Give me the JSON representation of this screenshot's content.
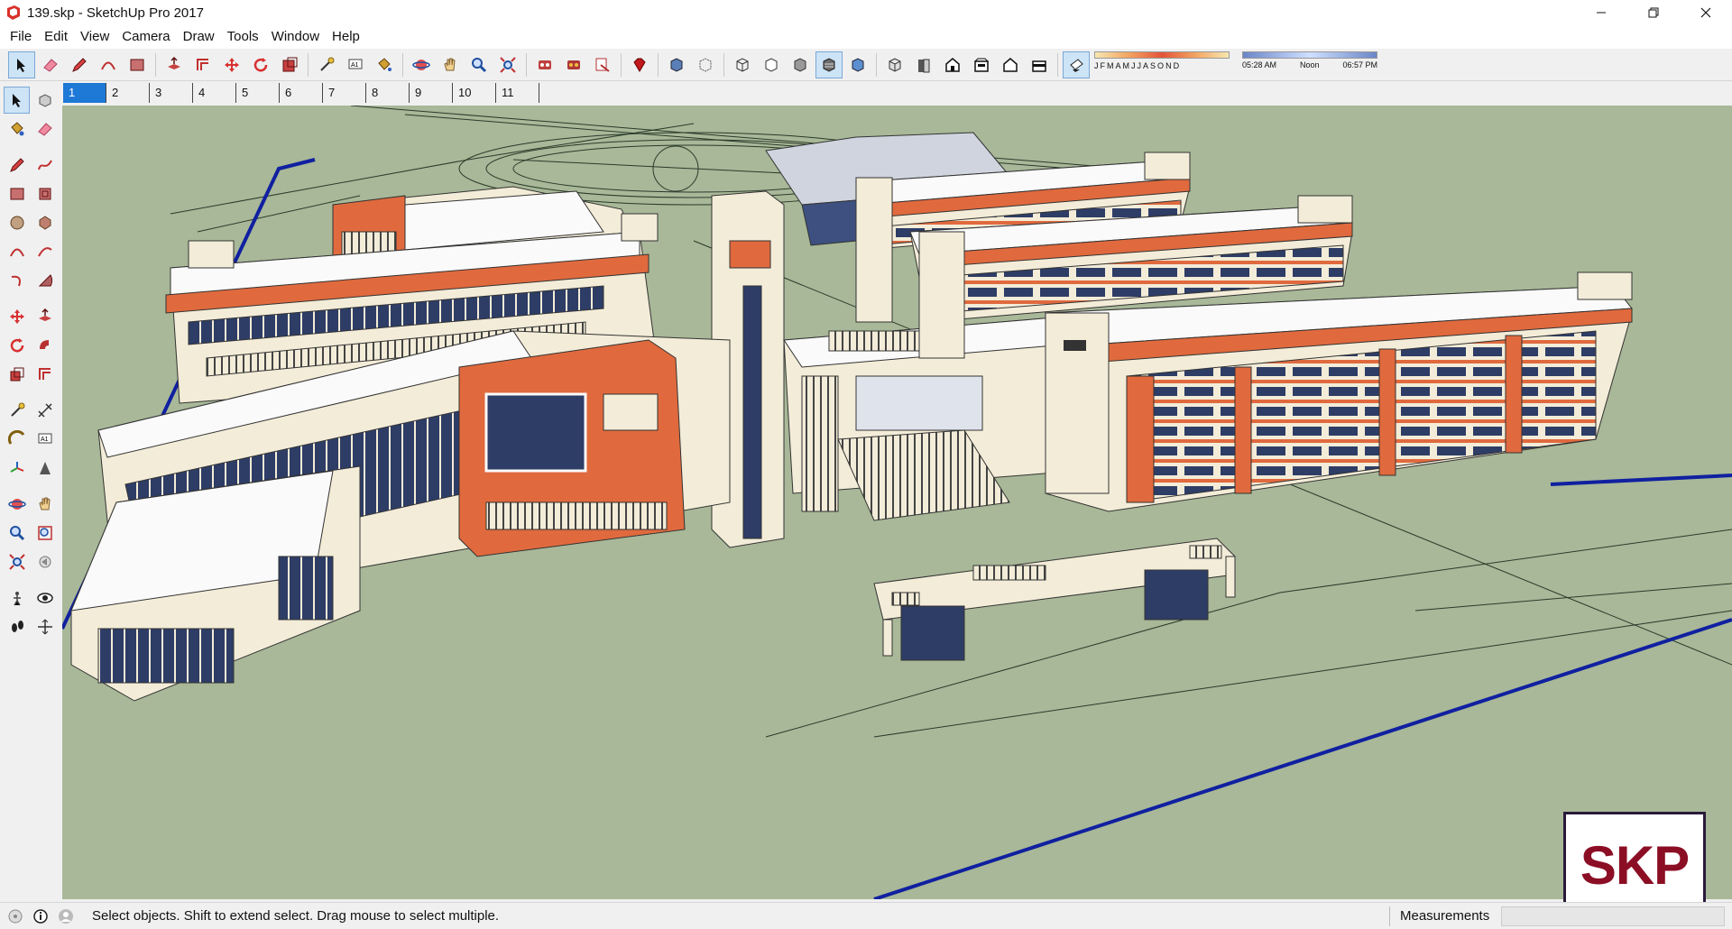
{
  "window": {
    "title": "139.skp - SketchUp Pro 2017",
    "app_icon": "sketchup-logo-icon",
    "controls": [
      "minimize-icon",
      "restore-icon",
      "close-icon"
    ]
  },
  "menu": {
    "items": [
      "File",
      "Edit",
      "View",
      "Camera",
      "Draw",
      "Tools",
      "Window",
      "Help"
    ]
  },
  "toolbar": {
    "groups": [
      [
        "select-icon",
        "eraser-icon",
        "pencil-icon",
        "arc-icon",
        "rectangle-icon"
      ],
      [
        "push-pull-icon",
        "offset-icon",
        "move-icon",
        "rotate-icon",
        "scale-icon"
      ],
      [
        "tape-measure-icon",
        "text-icon",
        "paint-bucket-icon"
      ],
      [
        "orbit-icon",
        "pan-icon",
        "zoom-icon",
        "zoom-extents-icon"
      ],
      [
        "3d-warehouse-icon",
        "extension-warehouse-icon",
        "layout-icon"
      ],
      [
        "ruby-icon"
      ],
      [
        "xray-icon",
        "back-edges-icon"
      ],
      [
        "wireframe-icon",
        "hidden-line-icon",
        "shaded-icon",
        "shaded-textures-icon",
        "monochrome-icon"
      ],
      [
        "iso-view-icon",
        "top-view-icon",
        "front-view-icon",
        "right-view-icon",
        "back-view-icon",
        "left-view-icon"
      ],
      [
        "shadows-toggle-icon"
      ]
    ],
    "shadow_months": [
      "J",
      "F",
      "M",
      "A",
      "M",
      "J",
      "J",
      "A",
      "S",
      "O",
      "N",
      "D"
    ],
    "shadow_times": {
      "start": "05:28 AM",
      "mid": "Noon",
      "end": "06:57 PM"
    }
  },
  "scenes": {
    "tabs": [
      "1",
      "2",
      "3",
      "4",
      "5",
      "6",
      "7",
      "8",
      "9",
      "10",
      "11"
    ],
    "active": "1"
  },
  "left_tools": [
    [
      "select-icon",
      "component-icon"
    ],
    [
      "paint-bucket-icon",
      "eraser-icon"
    ],
    [
      "pencil-icon",
      "freehand-icon"
    ],
    [
      "rectangle-icon",
      "rotated-rectangle-icon"
    ],
    [
      "circle-icon",
      "polygon-icon"
    ],
    [
      "arc-icon",
      "two-point-arc-icon"
    ],
    [
      "three-point-arc-icon",
      "pie-icon"
    ],
    [
      "move-icon",
      "push-pull-icon"
    ],
    [
      "rotate-icon",
      "follow-me-icon"
    ],
    [
      "scale-icon",
      "offset-icon"
    ],
    [
      "tape-measure-icon",
      "dimension-icon"
    ],
    [
      "protractor-icon",
      "text-icon"
    ],
    [
      "axes-icon",
      "3d-text-icon"
    ],
    [
      "orbit-icon",
      "pan-icon"
    ],
    [
      "zoom-icon",
      "zoom-window-icon"
    ],
    [
      "zoom-extents-icon",
      "previous-view-icon"
    ],
    [
      "position-camera-icon",
      "look-around-icon"
    ],
    [
      "walk-icon",
      "section-plane-icon"
    ]
  ],
  "watermark": {
    "text": "SKP",
    "color": "#8b0e25"
  },
  "status": {
    "icons": [
      "geolocation-icon",
      "credits-icon",
      "user-icon"
    ],
    "message": "Select objects. Shift to extend select. Drag mouse to select multiple.",
    "measurements_label": "Measurements",
    "measurements_value": ""
  },
  "colors": {
    "ground": "#a8b898",
    "facade_orange": "#e06a3e",
    "cream": "#f3ecd8",
    "glass": "#2e3d66",
    "selection": "#1e78d6"
  }
}
